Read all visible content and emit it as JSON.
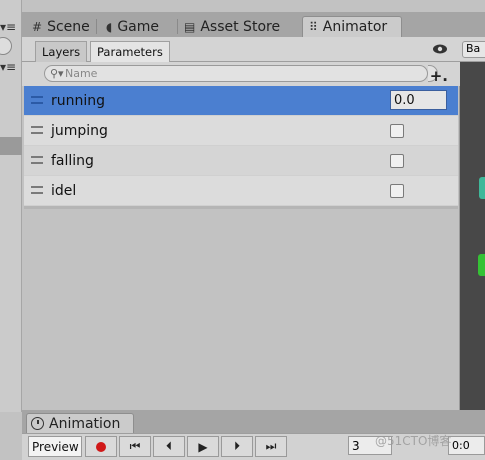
{
  "window": {
    "tabs": [
      {
        "label": "Scene",
        "icon": "grid-icon"
      },
      {
        "label": "Game",
        "icon": "pacman-icon"
      },
      {
        "label": "Asset Store",
        "icon": "store-icon"
      },
      {
        "label": "Animator",
        "icon": "animator-icon",
        "active": true
      }
    ]
  },
  "animator": {
    "subtabs": [
      "Layers",
      "Parameters"
    ],
    "active_subtab": "Parameters",
    "search": {
      "placeholder": "Name",
      "value": ""
    },
    "add_label": "+.",
    "breadcrumb": "Ba",
    "parameters": [
      {
        "name": "running",
        "type": "float",
        "value": "0.0",
        "selected": true
      },
      {
        "name": "jumping",
        "type": "bool",
        "value": false
      },
      {
        "name": "falling",
        "type": "bool",
        "value": false
      },
      {
        "name": "idel",
        "type": "bool",
        "value": false
      }
    ]
  },
  "animation": {
    "tab_label": "Animation",
    "preview_label": "Preview",
    "frame_value": "3",
    "time_value": "0:0",
    "watermark": "@51CTO博客"
  },
  "colors": {
    "selected_row": "#4b7fd0",
    "record": "#d01818",
    "node_green": "#35c235",
    "node_teal": "#3fb89a"
  }
}
